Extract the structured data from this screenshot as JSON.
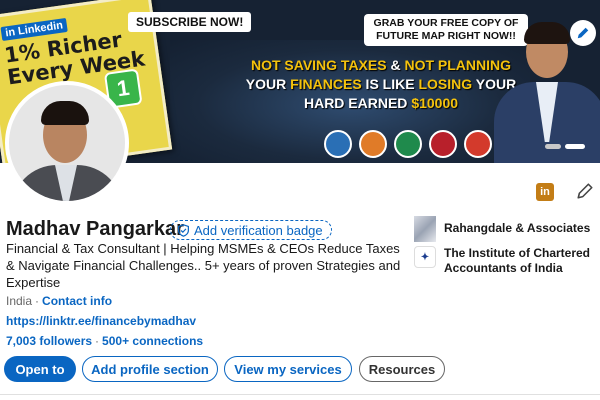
{
  "banner": {
    "book_brand": "in Linkedin",
    "book_title": "1% Richer Every Week",
    "book_number": "1",
    "subscribe_label": "SUBSCRIBE NOW!",
    "grab_copy": "GRAB YOUR FREE COPY OF FUTURE MAP RIGHT NOW!!",
    "headline_part1": "NOT SAVING TAXES",
    "headline_part2": " & ",
    "headline_part3": "NOT PLANNING",
    "headline_part4": "YOUR ",
    "headline_part5": "FINANCES",
    "headline_part6": " IS LIKE ",
    "headline_part7": "LOSING",
    "headline_part8": " YOUR",
    "headline_part9": "HARD EARNED ",
    "headline_part10": "$10000",
    "logo_colors": [
      "#2a6fb5",
      "#e07b28",
      "#1f8a4c",
      "#b8202b",
      "#d33a2c"
    ]
  },
  "profile": {
    "name": "Madhav Pangarkar",
    "verification_label": "Add verification badge",
    "headline": "Financial & Tax Consultant | Helping MSMEs & CEOs Reduce Taxes & Navigate Financial Challenges.. 5+ years of proven Strategies and Expertise",
    "location": "India",
    "contact_label": "Contact info",
    "website": "https://linktr.ee/financebymadhav",
    "followers": "7,003 followers",
    "connections": "500+ connections"
  },
  "actions": {
    "open_to": "Open to",
    "add_section": "Add profile section",
    "view_services": "View my services",
    "resources": "Resources"
  },
  "right_rail": {
    "company": "Rahangdale & Associates",
    "education": "The Institute of Chartered Accountants of India"
  },
  "colors": {
    "linkedin_blue": "#0a66c2",
    "banner_bg": "#162233",
    "highlight_yellow": "#f4c20d"
  }
}
